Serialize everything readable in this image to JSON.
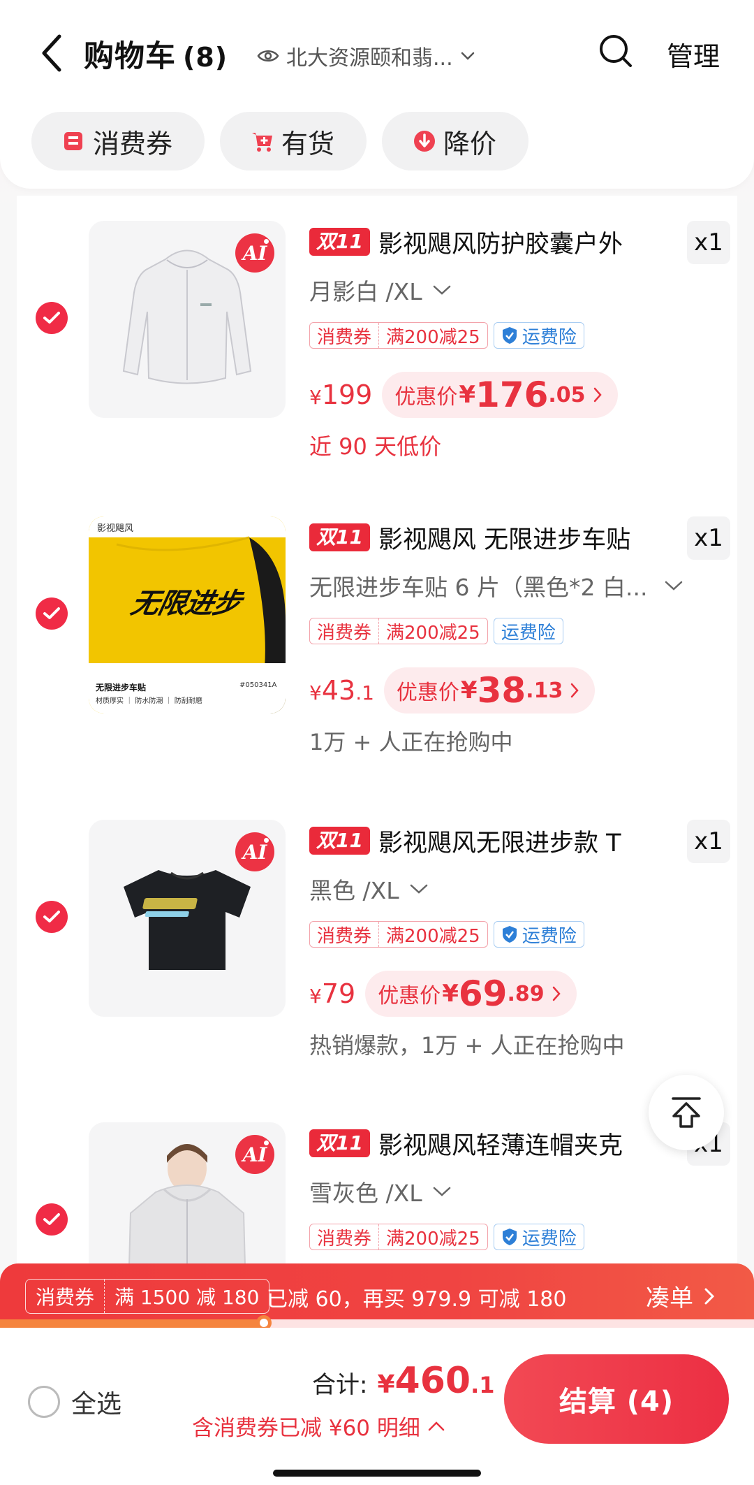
{
  "header": {
    "title": "购物车",
    "count": "(8)",
    "address": "北大资源颐和翡...",
    "manage_label": "管理"
  },
  "filters": [
    {
      "label": "消费券",
      "icon": "coupon-icon"
    },
    {
      "label": "有货",
      "icon": "cart-plus-icon"
    },
    {
      "label": "降价",
      "icon": "price-down-icon"
    }
  ],
  "items": [
    {
      "badge": "双11",
      "title": "影视飓风防护胶囊户外",
      "qty": "x1",
      "variant": "月影白 /XL",
      "coupon_tag": "消费券",
      "coupon_rule": "满200减25",
      "insurance": "运费险",
      "insurance_icon": true,
      "price_symbol": "¥",
      "price_int": "199",
      "price_dec": "",
      "deal_label": "优惠价",
      "deal_symbol": "¥",
      "deal_int": "176",
      "deal_dec": ".05",
      "note": "近 90 天低价",
      "note_style": "red",
      "ai": true,
      "image": "white-jacket"
    },
    {
      "badge": "双11",
      "title": "影视飓风 无限进步车贴",
      "qty": "x1",
      "variant": "无限进步车贴 6 片（黑色*2 白...",
      "coupon_tag": "消费券",
      "coupon_rule": "满200减25",
      "insurance": "运费险",
      "insurance_icon": false,
      "price_symbol": "¥",
      "price_int": "43",
      "price_dec": ".1",
      "deal_label": "优惠价",
      "deal_symbol": "¥",
      "deal_int": "38",
      "deal_dec": ".13",
      "note": "1万 + 人正在抢购中",
      "note_style": "gray",
      "ai": false,
      "image": "car-sticker",
      "sticker": {
        "brand": "影视飓风",
        "headline": "无限进步",
        "name": "无限进步车贴",
        "features": "材质厚实 ｜ 防水防潮 ｜ 防刮耐磨",
        "code": "#050341A"
      }
    },
    {
      "badge": "双11",
      "title": "影视飓风无限进步款 T",
      "qty": "x1",
      "variant": "黑色 /XL",
      "coupon_tag": "消费券",
      "coupon_rule": "满200减25",
      "insurance": "运费险",
      "insurance_icon": true,
      "price_symbol": "¥",
      "price_int": "79",
      "price_dec": "",
      "deal_label": "优惠价",
      "deal_symbol": "¥",
      "deal_int": "69",
      "deal_dec": ".89",
      "note": "热销爆款，1万 + 人正在抢购中",
      "note_style": "gray",
      "ai": true,
      "image": "black-tshirt"
    },
    {
      "badge": "双11",
      "title": "影视飓风轻薄连帽夹克",
      "qty": "x1",
      "variant": "雪灰色 /XL",
      "coupon_tag": "消费券",
      "coupon_rule": "满200减25",
      "insurance": "运费险",
      "insurance_icon": true,
      "ai": true,
      "image": "grey-hooded-jacket"
    }
  ],
  "promo": {
    "coupon_tag": "消费券",
    "coupon_rule": "满 1500 减 180",
    "text": "已减 60，再买 979.9 可减 180",
    "action": "凑单",
    "progress": 0.35
  },
  "bottom": {
    "select_all": "全选",
    "total_label": "合计:",
    "total_symbol": "¥",
    "total_int": "460",
    "total_dec": ".1",
    "saved": "含消费券已减 ¥60 明细",
    "checkout": "结算 (4)"
  },
  "colors": {
    "accent": "#e8323f",
    "check": "#f02b46",
    "insurance": "#2d7fd7"
  }
}
